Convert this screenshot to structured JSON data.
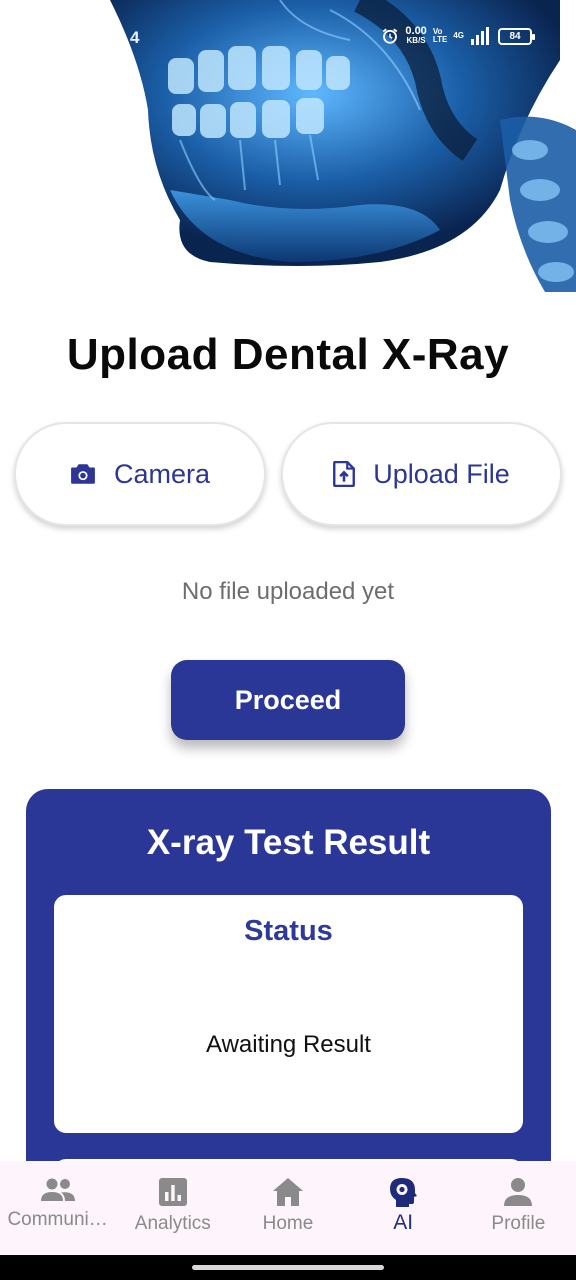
{
  "status_bar": {
    "time": "4",
    "net_speed": "0.00",
    "net_unit": "KB/S",
    "volte_top": "Vo",
    "volte_bottom": "LTE",
    "network": "4G",
    "battery": "84"
  },
  "page": {
    "title": "Upload Dental X-Ray",
    "camera_label": "Camera",
    "upload_label": "Upload File",
    "no_file_text": "No file uploaded yet",
    "proceed_label": "Proceed"
  },
  "result": {
    "title": "X-ray Test Result",
    "status_label": "Status",
    "status_value": "Awaiting Result"
  },
  "bottom_nav": {
    "items": [
      {
        "label": "Communi…",
        "icon": "people-icon",
        "active": false
      },
      {
        "label": "Analytics",
        "icon": "analytics-icon",
        "active": false
      },
      {
        "label": "Home",
        "icon": "home-icon",
        "active": false
      },
      {
        "label": "AI",
        "icon": "ai-head-gear-icon",
        "active": true
      },
      {
        "label": "Profile",
        "icon": "person-icon",
        "active": false
      }
    ]
  },
  "colors": {
    "primary": "#2a3797",
    "accent_text": "#2d3695",
    "nav_background": "#fdf5fb",
    "muted_text": "#6d6d6d"
  }
}
